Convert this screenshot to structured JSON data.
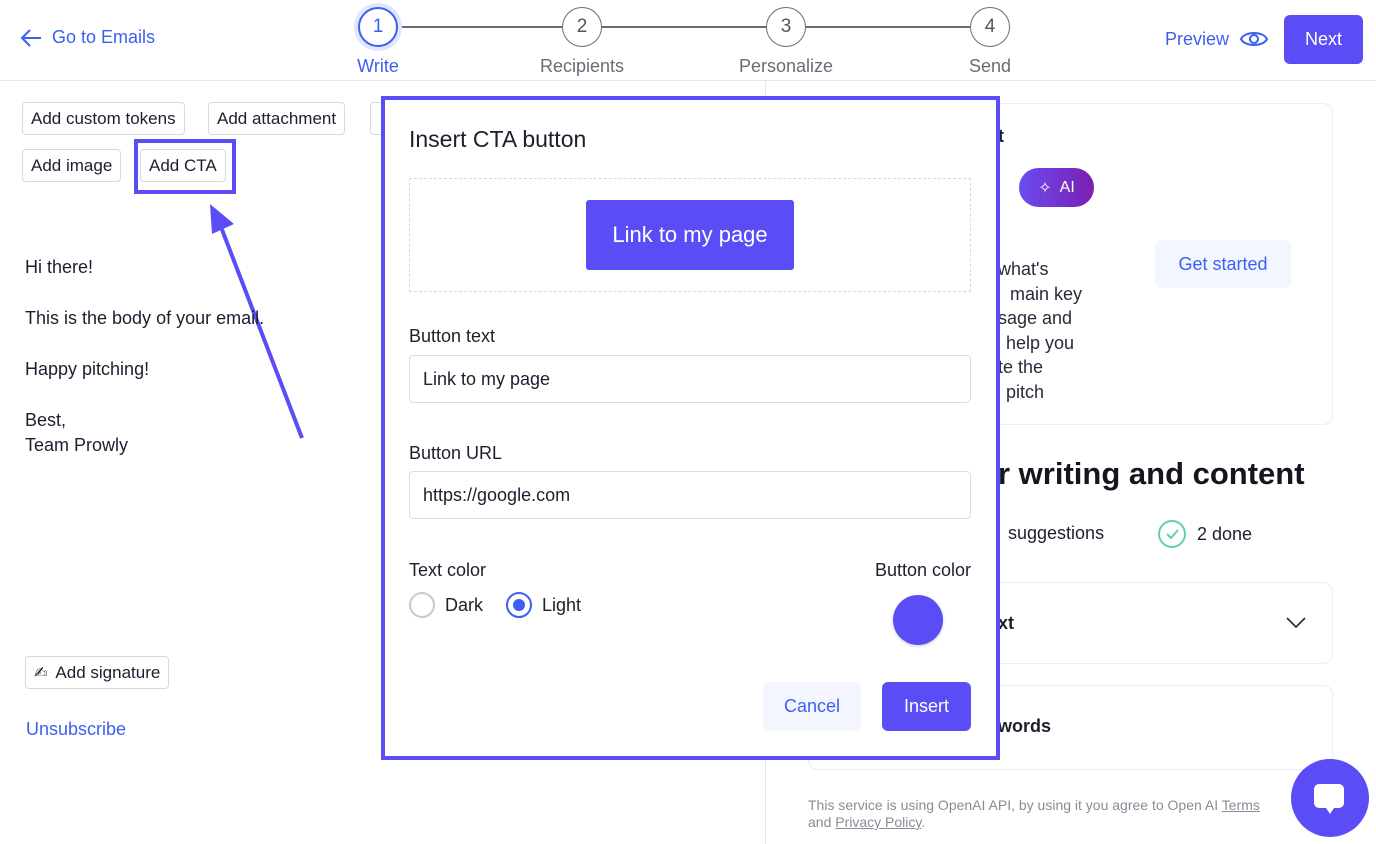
{
  "header": {
    "back_label": "Go to Emails",
    "steps": [
      {
        "num": "1",
        "label": "Write",
        "active": true
      },
      {
        "num": "2",
        "label": "Recipients"
      },
      {
        "num": "3",
        "label": "Personalize"
      },
      {
        "num": "4",
        "label": "Send"
      }
    ],
    "preview_label": "Preview",
    "next_label": "Next"
  },
  "toolbar": {
    "buttons": [
      "Add custom tokens",
      "Add attachment",
      "Add image",
      "Add CTA"
    ]
  },
  "email_body": {
    "lines": [
      "Hi there!",
      "This is the body of your email.",
      "Happy pitching!",
      "Best,",
      "Team Prowly"
    ]
  },
  "left_footer": {
    "signature_label": "Add signature",
    "unsubscribe_label": "Unsubscribe"
  },
  "right_panel": {
    "card_title_fragment": "t",
    "ai_label": "AI",
    "card_text_fragments": [
      "what's",
      "main key",
      "sage and",
      "help you",
      "te the",
      "pitch"
    ],
    "get_started_label": "Get started",
    "section_heading_fragment": "r writing and content",
    "suggestions_fragment": "suggestions",
    "done_label": "2 done",
    "accordion1_fragment": "xt",
    "accordion2_fragment": "words",
    "disclaimer": "This service is using OpenAI API, by using it you agree to Open AI",
    "terms_label": "Terms",
    "and_label": "and",
    "privacy_label": "Privacy Policy"
  },
  "modal": {
    "title": "Insert CTA button",
    "preview_button_label": "Link to my page",
    "button_text_label": "Button text",
    "button_text_value": "Link to my page",
    "button_url_label": "Button URL",
    "button_url_value": "https://google.com",
    "text_color_label": "Text color",
    "text_color_options": [
      "Dark",
      "Light"
    ],
    "text_color_selected": "Light",
    "button_color_label": "Button color",
    "button_color_value": "#5b4df5",
    "cancel_label": "Cancel",
    "insert_label": "Insert"
  },
  "colors": {
    "accent": "#5b4df5",
    "link": "#3d5ff0",
    "success": "#5fd3a0"
  }
}
